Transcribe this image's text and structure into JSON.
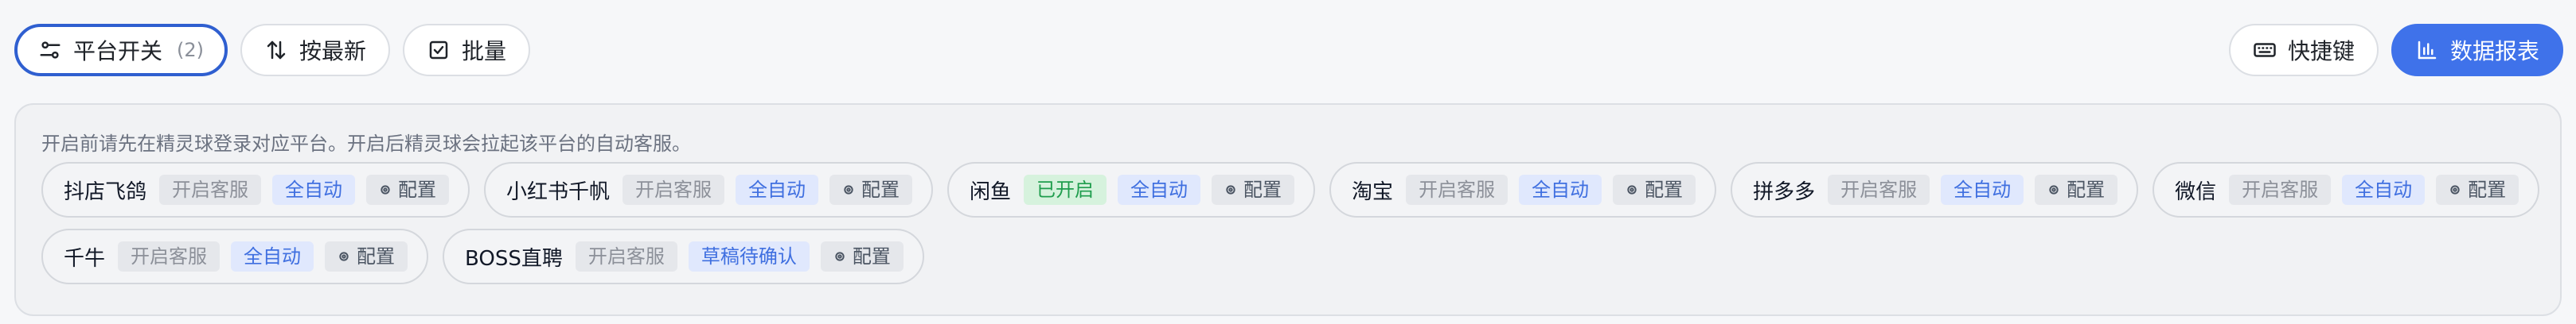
{
  "toolbar": {
    "platform_switch": {
      "label": "平台开关",
      "count": "(2)",
      "icon": "sliders-icon"
    },
    "sort_latest": {
      "label": "按最新",
      "icon": "sort-arrows-icon"
    },
    "batch": {
      "label": "批量",
      "icon": "checkbox-icon"
    },
    "shortcuts": {
      "label": "快捷键",
      "icon": "keyboard-icon"
    },
    "data_report": {
      "label": "数据报表",
      "icon": "bar-chart-icon"
    }
  },
  "panel": {
    "notice": "开启前请先在精灵球登录对应平台。开启后精灵球会拉起该平台的自动客服。",
    "platforms": [
      {
        "name": "抖店飞鸽",
        "status": "开启客服",
        "status_state": "off",
        "mode": "全自动",
        "config": "配置"
      },
      {
        "name": "小红书千帆",
        "status": "开启客服",
        "status_state": "off",
        "mode": "全自动",
        "config": "配置"
      },
      {
        "name": "闲鱼",
        "status": "已开启",
        "status_state": "on",
        "mode": "全自动",
        "config": "配置"
      },
      {
        "name": "淘宝",
        "status": "开启客服",
        "status_state": "off",
        "mode": "全自动",
        "config": "配置"
      },
      {
        "name": "拼多多",
        "status": "开启客服",
        "status_state": "off",
        "mode": "全自动",
        "config": "配置"
      },
      {
        "name": "微信",
        "status": "开启客服",
        "status_state": "off",
        "mode": "全自动",
        "config": "配置"
      },
      {
        "name": "千牛",
        "status": "开启客服",
        "status_state": "off",
        "mode": "全自动",
        "config": "配置"
      },
      {
        "name": "BOSS直聘",
        "status": "开启客服",
        "status_state": "off",
        "mode": "草稿待确认",
        "config": "配置"
      }
    ]
  },
  "colors": {
    "primary": "#3f72ea",
    "active_border": "#2f5fd0",
    "enabled_green": "#1f9d4d",
    "auto_blue": "#3f6fe0"
  }
}
